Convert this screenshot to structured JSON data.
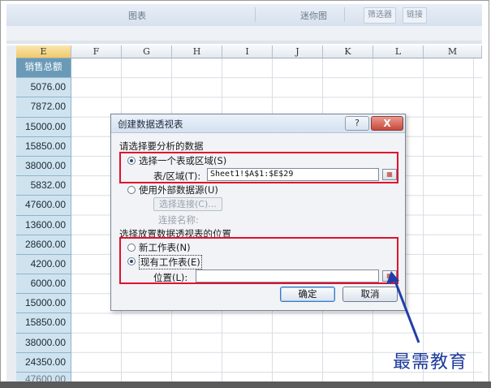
{
  "ribbon": {
    "group_chart": "图表",
    "group_sparklines": "迷你图",
    "btn_slicer": "筛选器",
    "btn_link": "链接"
  },
  "columns": [
    "E",
    "F",
    "G",
    "H",
    "I",
    "J",
    "K",
    "L",
    "M"
  ],
  "column_e": {
    "header": "销售总额",
    "values": [
      "5076.00",
      "7872.00",
      "15000.00",
      "15850.00",
      "38000.00",
      "5832.00",
      "47600.00",
      "13600.00",
      "28600.00",
      "4200.00",
      "6000.00",
      "15000.00",
      "15850.00",
      "38000.00",
      "24350.00",
      "47600.00"
    ]
  },
  "dialog": {
    "title": "创建数据透视表",
    "help": "?",
    "close": "X",
    "section1": "请选择要分析的数据",
    "opt_select_range": "选择一个表或区域(S)",
    "table_range_label": "表/区域(T):",
    "table_range_value": "Sheet1!$A$1:$E$29",
    "opt_external": "使用外部数据源(U)",
    "choose_conn_btn": "选择连接(C)...",
    "conn_name_label": "连接名称:",
    "section2": "选择放置数据透视表的位置",
    "opt_new_sheet": "新工作表(N)",
    "opt_existing_sheet": "现有工作表(E)",
    "location_label": "位置(L):",
    "location_value": "",
    "ok": "确定",
    "cancel": "取消"
  },
  "watermark": "最需教育",
  "colors": {
    "highlight": "#e0102f",
    "arrow": "#1f3fa8",
    "selected_column": "#cfe3ef"
  }
}
